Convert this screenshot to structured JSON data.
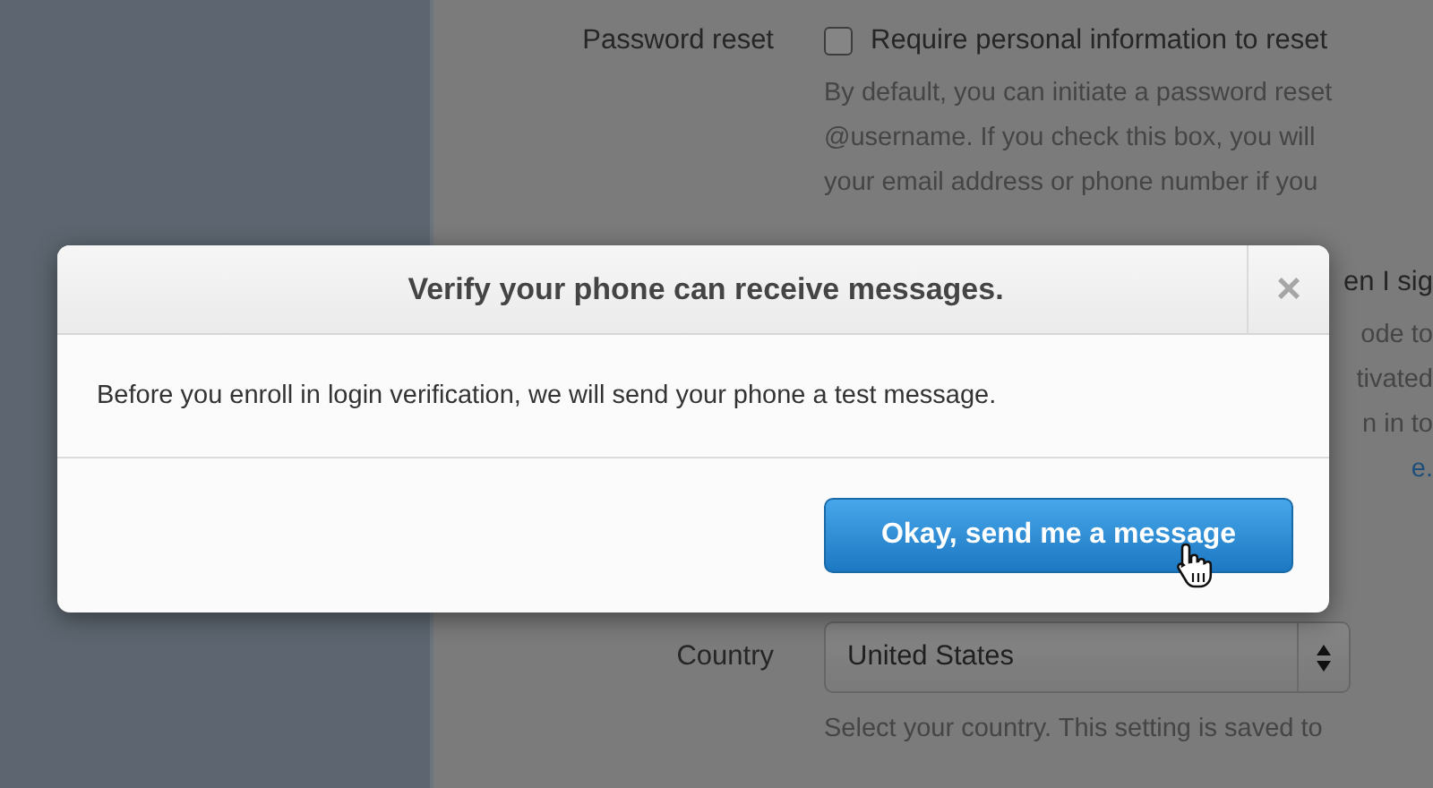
{
  "settings": {
    "password_reset": {
      "label": "Password reset",
      "checkbox": {
        "label": "Require personal information to reset",
        "checked": false
      },
      "help_lines": [
        "By default, you can initiate a password reset",
        "@username. If you check this box, you will",
        "your email address or phone number if you"
      ]
    },
    "hidden_fragments": [
      {
        "text": "en I sig",
        "kind": "label"
      },
      {
        "text": "ode to",
        "kind": "help"
      },
      {
        "text": "tivated",
        "kind": "help"
      },
      {
        "text": "n in to",
        "kind": "help"
      },
      {
        "text": "e.",
        "kind": "link"
      }
    ],
    "country": {
      "label": "Country",
      "value": "United States",
      "help": "Select your country. This setting is saved to"
    }
  },
  "dialog": {
    "title": "Verify your phone can receive messages.",
    "close": "×",
    "message": "Before you enroll in login verification, we will send your phone a test message.",
    "button": "Okay, send me a message"
  }
}
